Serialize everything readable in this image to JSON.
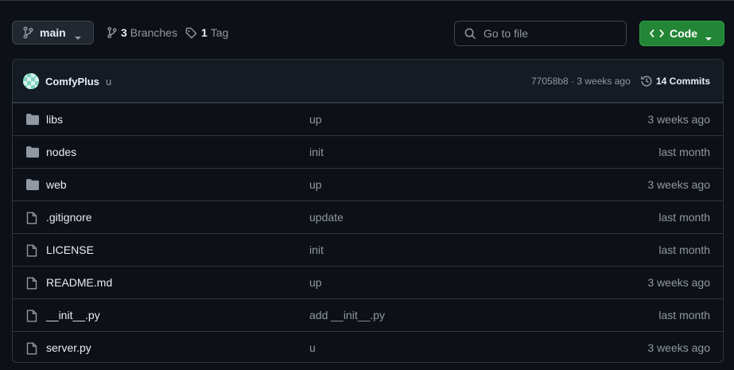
{
  "branch": {
    "name": "main"
  },
  "meta": {
    "branches_count": "3",
    "branches_label": "Branches",
    "tags_count": "1",
    "tags_label": "Tag"
  },
  "search": {
    "placeholder": "Go to file"
  },
  "code_button": {
    "label": "Code"
  },
  "commit": {
    "author": "ComfyPlus",
    "message": "u",
    "hash_time": "77058b8 · 3 weeks ago",
    "commits_label": "14 Commits"
  },
  "files": [
    {
      "name": "libs",
      "type": "folder",
      "message": "up",
      "date": "3 weeks ago"
    },
    {
      "name": "nodes",
      "type": "folder",
      "message": "init",
      "date": "last month"
    },
    {
      "name": "web",
      "type": "folder",
      "message": "up",
      "date": "3 weeks ago"
    },
    {
      "name": ".gitignore",
      "type": "file",
      "message": "update",
      "date": "last month"
    },
    {
      "name": "LICENSE",
      "type": "file",
      "message": "init",
      "date": "last month"
    },
    {
      "name": "README.md",
      "type": "file",
      "message": "up",
      "date": "3 weeks ago"
    },
    {
      "name": "__init__.py",
      "type": "file",
      "message": "add __init__.py",
      "date": "last month"
    },
    {
      "name": "server.py",
      "type": "file",
      "message": "u",
      "date": "3 weeks ago"
    }
  ],
  "colors": {
    "background": "#0d1117",
    "accent_green": "#238636",
    "border": "#30363d",
    "muted_text": "#9198a1"
  }
}
